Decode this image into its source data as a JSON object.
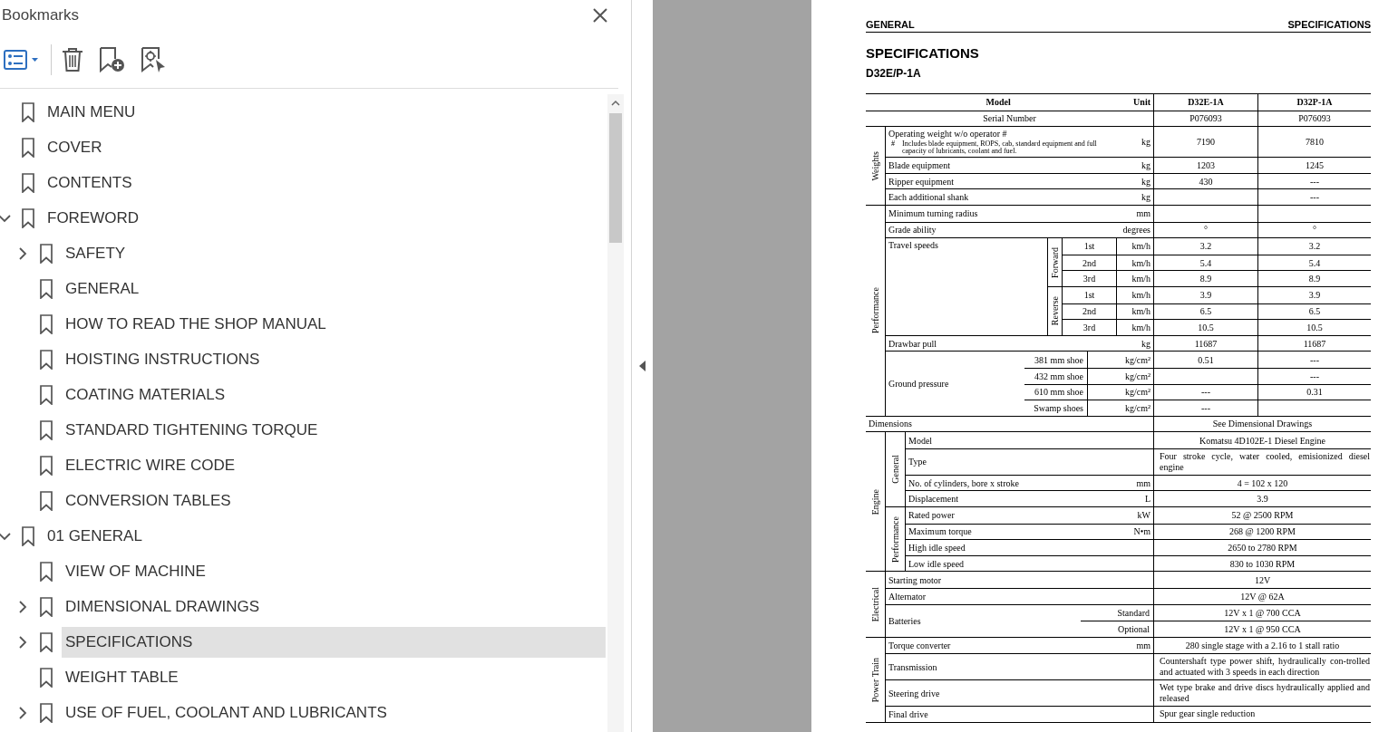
{
  "bookmarks": {
    "title": "Bookmarks",
    "items": [
      {
        "label": "MAIN MENU",
        "expandable": false,
        "expanded": false,
        "selected": false
      },
      {
        "label": "COVER",
        "expandable": false,
        "expanded": false,
        "selected": false
      },
      {
        "label": "CONTENTS",
        "expandable": false,
        "expanded": false,
        "selected": false
      },
      {
        "label": "FOREWORD",
        "expandable": true,
        "expanded": true,
        "selected": false,
        "children": [
          {
            "label": "SAFETY",
            "expandable": true,
            "expanded": false,
            "selected": false
          },
          {
            "label": "GENERAL",
            "expandable": false,
            "expanded": false,
            "selected": false
          },
          {
            "label": "HOW TO READ THE SHOP MANUAL",
            "expandable": false,
            "expanded": false,
            "selected": false
          },
          {
            "label": "HOISTING INSTRUCTIONS",
            "expandable": false,
            "expanded": false,
            "selected": false
          },
          {
            "label": "COATING MATERIALS",
            "expandable": false,
            "expanded": false,
            "selected": false
          },
          {
            "label": "STANDARD TIGHTENING TORQUE",
            "expandable": false,
            "expanded": false,
            "selected": false
          },
          {
            "label": "ELECTRIC WIRE CODE",
            "expandable": false,
            "expanded": false,
            "selected": false
          },
          {
            "label": "CONVERSION TABLES",
            "expandable": false,
            "expanded": false,
            "selected": false
          }
        ]
      },
      {
        "label": "01 GENERAL",
        "expandable": true,
        "expanded": true,
        "selected": false,
        "children": [
          {
            "label": "VIEW OF MACHINE",
            "expandable": false,
            "expanded": false,
            "selected": false
          },
          {
            "label": "DIMENSIONAL DRAWINGS",
            "expandable": true,
            "expanded": false,
            "selected": false
          },
          {
            "label": "SPECIFICATIONS",
            "expandable": true,
            "expanded": false,
            "selected": true
          },
          {
            "label": "WEIGHT TABLE",
            "expandable": false,
            "expanded": false,
            "selected": false
          },
          {
            "label": "USE OF FUEL, COOLANT AND LUBRICANTS",
            "expandable": true,
            "expanded": false,
            "selected": false
          }
        ]
      }
    ]
  },
  "document": {
    "header_left": "GENERAL",
    "header_right": "SPECIFICATIONS",
    "title": "SPECIFICATIONS",
    "subtitle": "D32E/P-1A",
    "table": {
      "columns": [
        "Model",
        "Unit",
        "D32E-1A",
        "D32P-1A"
      ],
      "serial": {
        "label": "Serial Number",
        "values": {
          "d32e_1a": "P076093",
          "d32p_1a": "P076093"
        }
      },
      "sections": [
        {
          "kind": "group",
          "label": "Weights",
          "items": [
            {
              "kind": "note",
              "label": "Operating weight w/o operator #",
              "note_mark": "#",
              "note": "Includes blade equipment, ROPS, cab, standard equipment and full capacity of lubricants, coolant and fuel.",
              "unit": "kg",
              "values": {
                "d32e_1a": "7190",
                "d32p_1a": "7810"
              }
            },
            {
              "kind": "row",
              "label": "Blade equipment",
              "unit": "kg",
              "values": {
                "d32e_1a": "1203",
                "d32p_1a": "1245"
              }
            },
            {
              "kind": "row",
              "label": "Ripper equipment",
              "unit": "kg",
              "values": {
                "d32e_1a": "430",
                "d32p_1a": "---"
              }
            },
            {
              "kind": "row",
              "label": "Each additional shank",
              "unit": "kg",
              "values": {
                "d32p_1a": "---"
              }
            }
          ]
        },
        {
          "kind": "group",
          "label": "Performance",
          "items": [
            {
              "kind": "row",
              "label": "Minimum turning radius",
              "unit": "mm"
            },
            {
              "kind": "row",
              "label": "Grade ability",
              "unit": "degrees",
              "values": {
                "d32e_1a": "°",
                "d32p_1a": "°"
              }
            },
            {
              "kind": "grouped",
              "label": "Travel speeds",
              "groups": [
                {
                  "label": "Forward",
                  "rows": [
                    {
                      "sub": "1st",
                      "unit": "km/h",
                      "values": {
                        "d32e_1a": "3.2",
                        "d32p_1a": "3.2"
                      }
                    },
                    {
                      "sub": "2nd",
                      "unit": "km/h",
                      "values": {
                        "d32e_1a": "5.4",
                        "d32p_1a": "5.4"
                      }
                    },
                    {
                      "sub": "3rd",
                      "unit": "km/h",
                      "values": {
                        "d32e_1a": "8.9",
                        "d32p_1a": "8.9"
                      }
                    }
                  ]
                },
                {
                  "label": "Reverse",
                  "rows": [
                    {
                      "sub": "1st",
                      "unit": "km/h",
                      "values": {
                        "d32e_1a": "3.9",
                        "d32p_1a": "3.9"
                      }
                    },
                    {
                      "sub": "2nd",
                      "unit": "km/h",
                      "values": {
                        "d32e_1a": "6.5",
                        "d32p_1a": "6.5"
                      }
                    },
                    {
                      "sub": "3rd",
                      "unit": "km/h",
                      "values": {
                        "d32e_1a": "10.5",
                        "d32p_1a": "10.5"
                      }
                    }
                  ]
                }
              ]
            },
            {
              "kind": "row",
              "label": "Drawbar pull",
              "unit": "kg",
              "values": {
                "d32e_1a": "11687",
                "d32p_1a": "11687"
              }
            },
            {
              "kind": "split",
              "label": "Ground pressure",
              "rows": [
                {
                  "sub": "381 mm shoe",
                  "unit": "kg/cm²",
                  "values": {
                    "d32e_1a": "0.51",
                    "d32p_1a": "---"
                  }
                },
                {
                  "sub": "432 mm shoe",
                  "unit": "kg/cm²",
                  "values": {
                    "d32p_1a": "---"
                  }
                },
                {
                  "sub": "610 mm shoe",
                  "unit": "kg/cm²",
                  "values": {
                    "d32e_1a": "---",
                    "d32p_1a": "0.31"
                  }
                },
                {
                  "sub": "Swamp shoes",
                  "unit": "kg/cm²",
                  "values": {
                    "d32e_1a": "---"
                  }
                }
              ]
            }
          ]
        },
        {
          "kind": "row",
          "label": "Dimensions",
          "value": "See Dimensional Drawings"
        },
        {
          "kind": "group",
          "label": "Engine",
          "subsections": [
            {
              "label": "General",
              "items": [
                {
                  "kind": "row",
                  "label": "Model",
                  "value": "Komatsu 4D102E-1 Diesel Engine"
                },
                {
                  "kind": "text",
                  "label": "Type",
                  "value": "Four stroke cycle, water cooled, emisionized diesel engine"
                },
                {
                  "kind": "row",
                  "label": "No. of cylinders, bore x stroke",
                  "unit": "mm",
                  "value": "4 = 102 x 120"
                },
                {
                  "kind": "row",
                  "label": "Displacement",
                  "unit": "L",
                  "value": "3.9"
                }
              ]
            },
            {
              "label": "Performance",
              "items": [
                {
                  "kind": "row",
                  "label": "Rated power",
                  "unit": "kW",
                  "value": "52 @ 2500 RPM"
                },
                {
                  "kind": "row",
                  "label": "Maximum torque",
                  "unit": "N•m",
                  "value": "268 @ 1200 RPM"
                },
                {
                  "kind": "row",
                  "label": "High idle speed",
                  "value": "2650 to 2780 RPM"
                },
                {
                  "kind": "row",
                  "label": "Low idle speed",
                  "value": "830 to 1030 RPM"
                }
              ]
            }
          ]
        },
        {
          "kind": "group",
          "label": "Electrical",
          "items": [
            {
              "kind": "row",
              "label": "Starting motor",
              "value": "12V"
            },
            {
              "kind": "row",
              "label": "Alternator",
              "value": "12V @ 62A"
            },
            {
              "kind": "split",
              "label": "Batteries",
              "rows": [
                {
                  "sub": "Standard",
                  "value": "12V x 1 @ 700 CCA"
                },
                {
                  "sub": "Optional",
                  "value": "12V x 1 @ 950 CCA"
                }
              ]
            }
          ]
        },
        {
          "kind": "group",
          "label": "Power Train",
          "items": [
            {
              "kind": "row",
              "label": "Torque converter",
              "unit": "mm",
              "value": "280 single stage with a 2.16 to 1 stall ratio"
            },
            {
              "kind": "text",
              "label": "Transmission",
              "value": "Countershaft type power shift, hydraulically con-trolled and actuated with 3 speeds in each direction"
            },
            {
              "kind": "text",
              "label": "Steering drive",
              "value": "Wet type brake and drive discs hydraulically applied and released"
            },
            {
              "kind": "text",
              "label": "Final drive",
              "value": "Spur gear single reduction"
            }
          ]
        }
      ]
    }
  }
}
